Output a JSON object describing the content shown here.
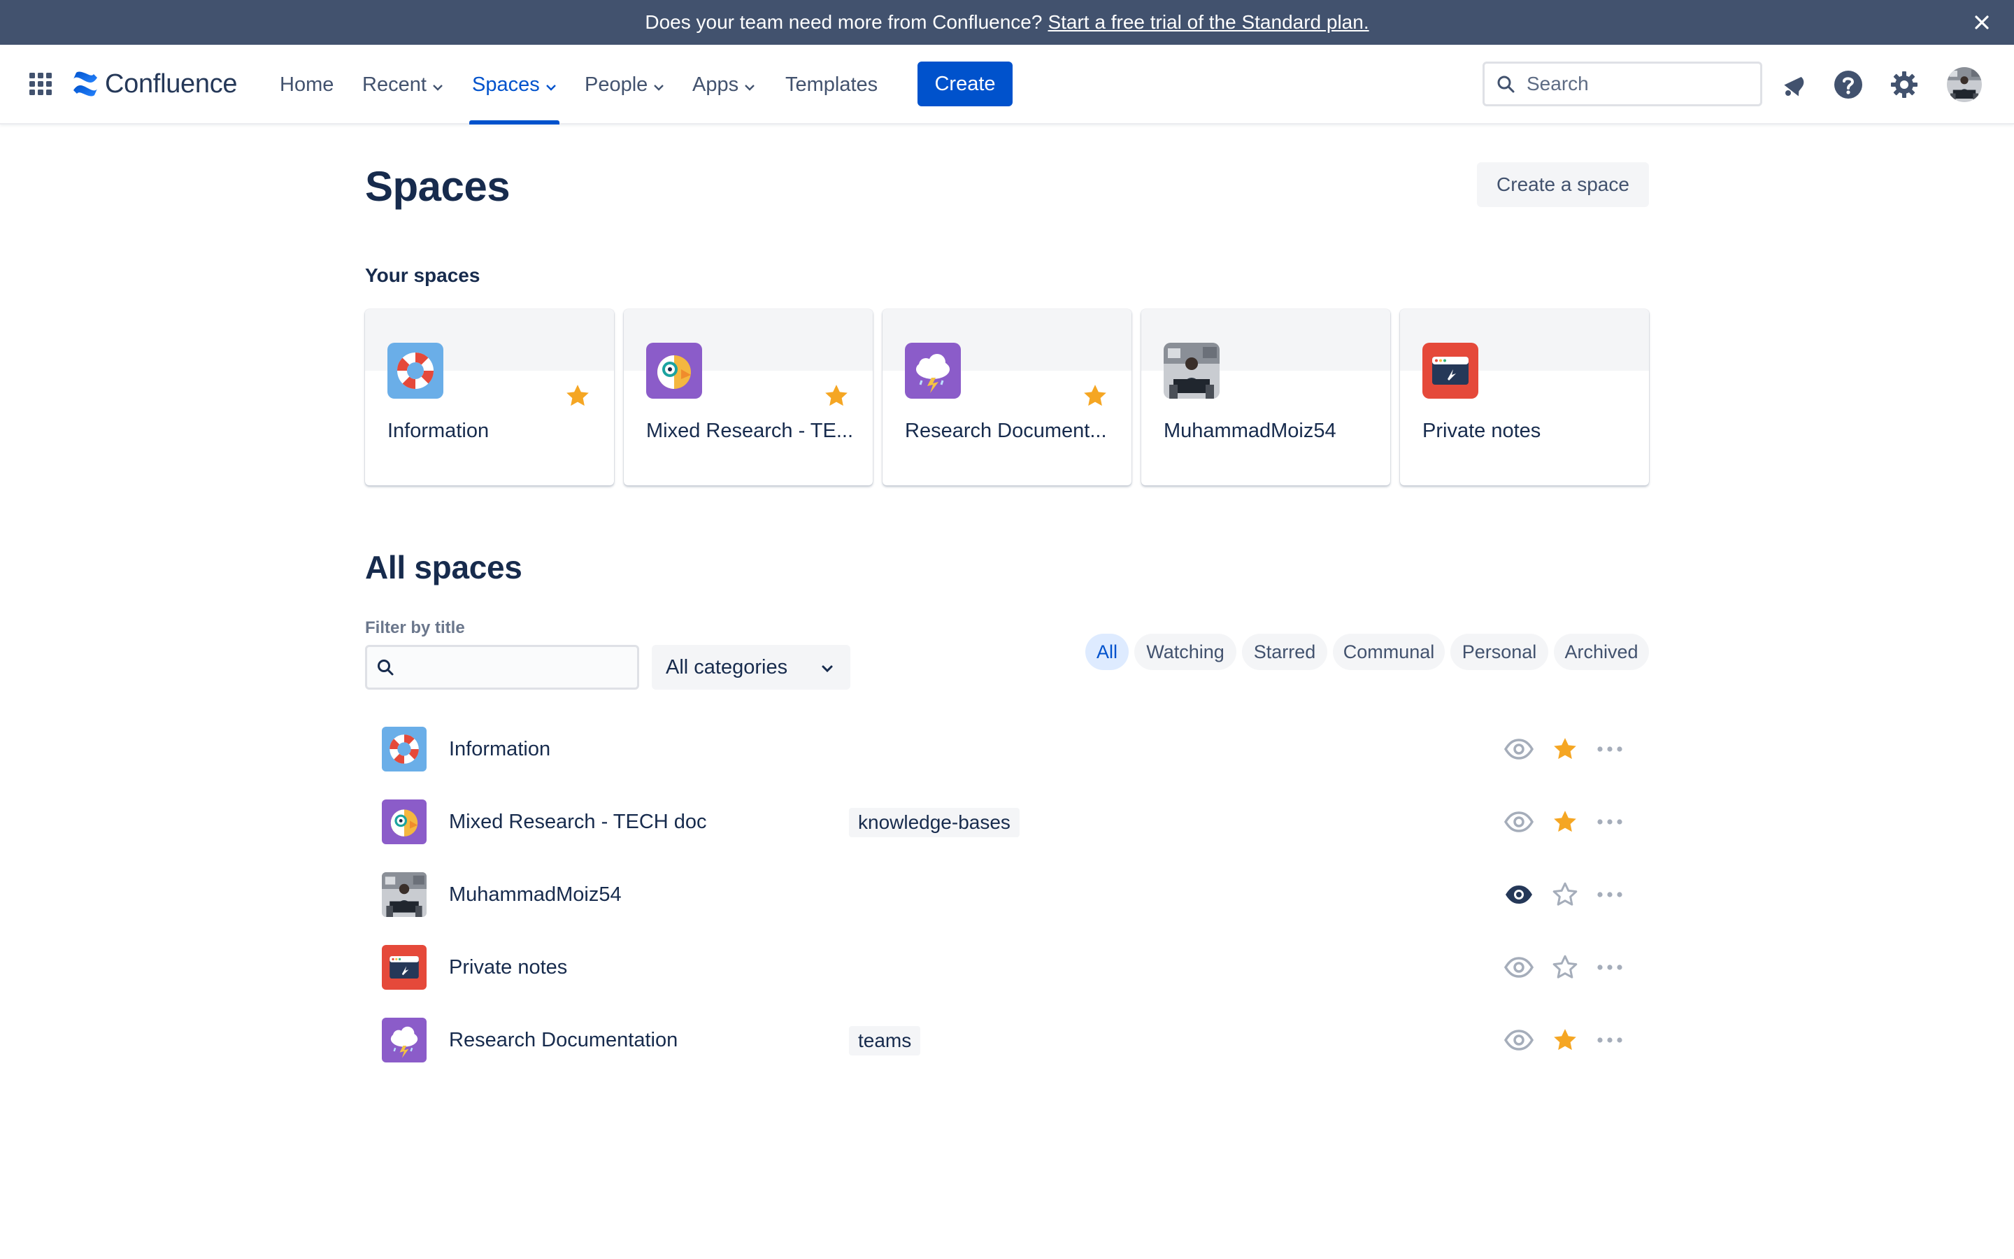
{
  "banner": {
    "message": "Does your team need more from Confluence?",
    "link": "Start a free trial of the Standard plan.",
    "close_icon": "close-icon"
  },
  "nav": {
    "logo_text": "Confluence",
    "items": [
      {
        "label": "Home",
        "has_dropdown": false
      },
      {
        "label": "Recent",
        "has_dropdown": true
      },
      {
        "label": "Spaces",
        "has_dropdown": true,
        "active": true
      },
      {
        "label": "People",
        "has_dropdown": true
      },
      {
        "label": "Apps",
        "has_dropdown": true
      },
      {
        "label": "Templates",
        "has_dropdown": false
      }
    ],
    "create_label": "Create",
    "search_placeholder": "Search",
    "icons": [
      "notification-icon",
      "help-icon",
      "settings-icon",
      "profile-avatar"
    ]
  },
  "page": {
    "title": "Spaces",
    "create_space_label": "Create a space",
    "your_spaces_heading": "Your spaces",
    "your_spaces": [
      {
        "name": "Information",
        "icon": "lifebuoy-icon",
        "starred": true
      },
      {
        "name": "Mixed Research - TE...",
        "icon": "parrot-icon",
        "starred": true
      },
      {
        "name": "Research Document...",
        "icon": "storm-cloud-icon",
        "starred": true
      },
      {
        "name": "MuhammadMoiz54",
        "icon": "user-photo",
        "starred": false
      },
      {
        "name": "Private notes",
        "icon": "browser-window-icon",
        "starred": false
      }
    ],
    "all_spaces_heading": "All spaces",
    "filter_label": "Filter by title",
    "filter_value": "",
    "category_select": "All categories",
    "filter_chips": [
      {
        "label": "All",
        "active": true
      },
      {
        "label": "Watching",
        "active": false
      },
      {
        "label": "Starred",
        "active": false
      },
      {
        "label": "Communal",
        "active": false
      },
      {
        "label": "Personal",
        "active": false
      },
      {
        "label": "Archived",
        "active": false
      }
    ],
    "all_spaces": [
      {
        "name": "Information",
        "icon": "lifebuoy-icon",
        "tag": "",
        "watching": false,
        "starred": true
      },
      {
        "name": "Mixed Research - TECH doc",
        "icon": "parrot-icon",
        "tag": "knowledge-bases",
        "watching": false,
        "starred": true
      },
      {
        "name": "MuhammadMoiz54",
        "icon": "user-photo",
        "tag": "",
        "watching": true,
        "starred": false
      },
      {
        "name": "Private notes",
        "icon": "browser-window-icon",
        "tag": "",
        "watching": false,
        "starred": false
      },
      {
        "name": "Research Documentation",
        "icon": "storm-cloud-icon",
        "tag": "teams",
        "watching": false,
        "starred": true
      }
    ]
  },
  "colors": {
    "banner_bg": "#42526e",
    "primary": "#0052cc",
    "star": "#f5a623",
    "text": "#172b4d",
    "subtle": "#42526e"
  }
}
